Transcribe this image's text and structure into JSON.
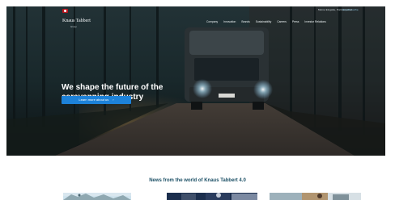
{
  "header": {
    "topbar_links": [
      "Meine Eingabe, Partnerportal",
      "Händlersuche"
    ],
    "brand_name": "Knaus Tabbert",
    "brand_sub": "Group"
  },
  "nav": {
    "items": [
      "Company",
      "Innovation",
      "Brands",
      "Sustainability",
      "Careers",
      "Press",
      "Investor Relations"
    ]
  },
  "hero": {
    "title_lines": [
      "We shape the future of the",
      "caravanning industry"
    ],
    "cta_label": "Learn more about us",
    "cta_arrow": "›"
  },
  "news": {
    "title": "News from the world of Knaus Tabbert 4.0"
  }
}
